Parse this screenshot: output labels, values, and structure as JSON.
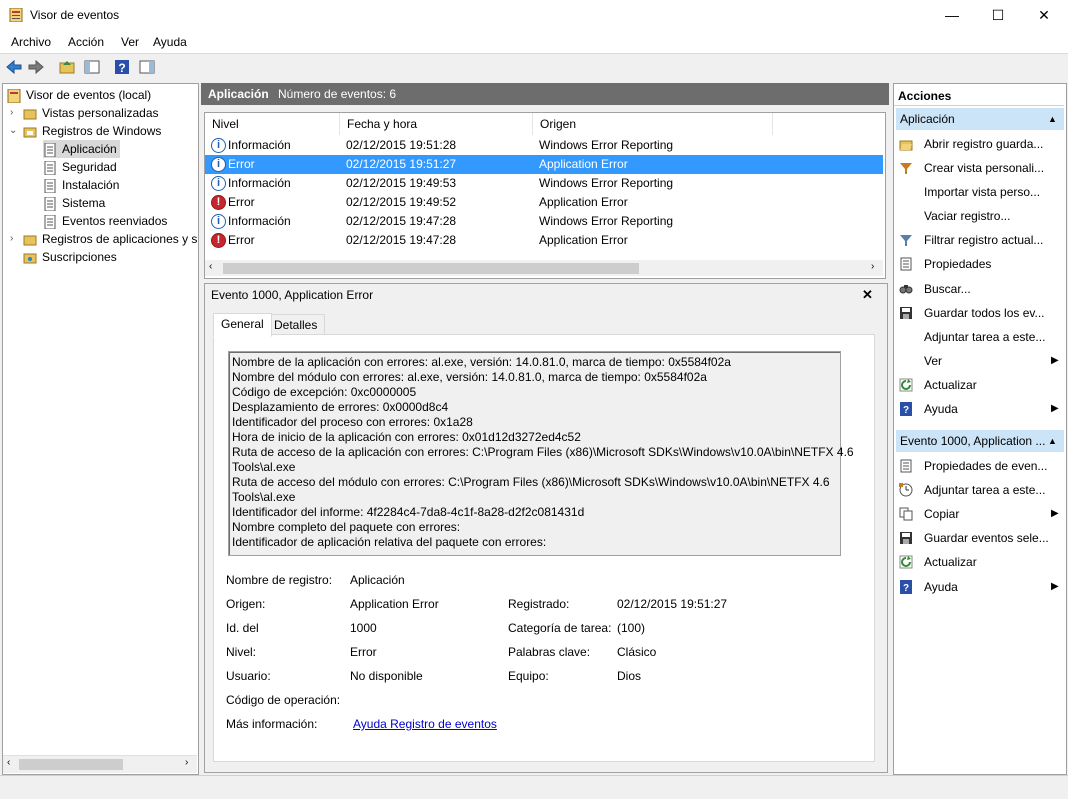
{
  "window": {
    "title": "Visor de eventos",
    "minimize": "—",
    "maximize": "☐",
    "close": "✕"
  },
  "menu": [
    "Archivo",
    "Acción",
    "Ver",
    "Ayuda"
  ],
  "tree": {
    "root": "Visor de eventos (local)",
    "custom_views": "Vistas personalizadas",
    "windows_logs": "Registros de Windows",
    "logs": [
      "Aplicación",
      "Seguridad",
      "Instalación",
      "Sistema",
      "Eventos reenviados"
    ],
    "app_services": "Registros de aplicaciones y s",
    "subscriptions": "Suscripciones"
  },
  "center": {
    "log_name": "Aplicación",
    "count_label": "Número de eventos: 6"
  },
  "columns": [
    "Nivel",
    "Fecha y hora",
    "Origen"
  ],
  "events": [
    {
      "level": "Información",
      "type": "info",
      "date": "02/12/2015 19:51:28",
      "source": "Windows Error Reporting"
    },
    {
      "level": "Error",
      "type": "err-info",
      "date": "02/12/2015 19:51:27",
      "source": "Application Error",
      "selected": true
    },
    {
      "level": "Información",
      "type": "info",
      "date": "02/12/2015 19:49:53",
      "source": "Windows Error Reporting"
    },
    {
      "level": "Error",
      "type": "err",
      "date": "02/12/2015 19:49:52",
      "source": "Application Error"
    },
    {
      "level": "Información",
      "type": "info",
      "date": "02/12/2015 19:47:28",
      "source": "Windows Error Reporting"
    },
    {
      "level": "Error",
      "type": "err",
      "date": "02/12/2015 19:47:28",
      "source": "Application Error"
    }
  ],
  "detail": {
    "title": "Evento 1000, Application Error",
    "close": "✕",
    "tabs": [
      "General",
      "Detalles"
    ],
    "message": [
      "Nombre de la aplicación con errores: al.exe, versión: 14.0.81.0, marca de tiempo: 0x5584f02a",
      "Nombre del módulo con errores: al.exe, versión: 14.0.81.0, marca de tiempo: 0x5584f02a",
      "Código de excepción: 0xc0000005",
      "Desplazamiento de errores: 0x0000d8c4",
      "Identificador del proceso con errores: 0x1a28",
      "Hora de inicio de la aplicación con errores: 0x01d12d3272ed4c52",
      "Ruta de acceso de la aplicación con errores: C:\\Program Files (x86)\\Microsoft SDKs\\Windows\\v10.0A\\bin\\NETFX 4.6",
      "Tools\\al.exe",
      "Ruta de acceso del módulo con errores: C:\\Program Files (x86)\\Microsoft SDKs\\Windows\\v10.0A\\bin\\NETFX 4.6",
      "Tools\\al.exe",
      "Identificador del informe: 4f2284c4-7da8-4c1f-8a28-d2f2c081431d",
      "Nombre completo del paquete con errores:",
      "Identificador de aplicación relativa del paquete con errores:"
    ],
    "fields": {
      "log_name_label": "Nombre de registro:",
      "log_name": "Aplicación",
      "source_label": "Origen:",
      "source": "Application Error",
      "logged_label": "Registrado:",
      "logged": "02/12/2015 19:51:27",
      "id_label": "Id. del",
      "id": "1000",
      "category_label": "Categoría de tarea:",
      "category": "(100)",
      "level_label": "Nivel:",
      "level": "Error",
      "keywords_label": "Palabras clave:",
      "keywords": "Clásico",
      "user_label": "Usuario:",
      "user": "No disponible",
      "computer_label": "Equipo:",
      "computer": "Dios",
      "opcode_label": "Código de operación:",
      "more_label": "Más información:",
      "more_link": "Ayuda Registro de eventos"
    }
  },
  "actions": {
    "header": "Acciones",
    "section1": "Aplicación",
    "items1": [
      {
        "label": "Abrir registro guarda...",
        "icon": "open-log-icon"
      },
      {
        "label": "Crear vista personali...",
        "icon": "filter-create-icon"
      },
      {
        "label": "Importar vista perso...",
        "icon": ""
      },
      {
        "label": "Vaciar registro...",
        "icon": ""
      },
      {
        "label": "Filtrar registro actual...",
        "icon": "filter-icon"
      },
      {
        "label": "Propiedades",
        "icon": "properties-icon"
      },
      {
        "label": "Buscar...",
        "icon": "find-icon"
      },
      {
        "label": "Guardar todos los ev...",
        "icon": "save-icon"
      },
      {
        "label": "Adjuntar tarea a este...",
        "icon": ""
      },
      {
        "label": "Ver",
        "icon": "",
        "submenu": true
      },
      {
        "label": "Actualizar",
        "icon": "refresh-icon"
      },
      {
        "label": "Ayuda",
        "icon": "help-icon",
        "submenu": true
      }
    ],
    "section2": "Evento 1000, Application ...",
    "items2": [
      {
        "label": "Propiedades de even...",
        "icon": "event-properties-icon"
      },
      {
        "label": "Adjuntar tarea a este...",
        "icon": "attach-task-icon"
      },
      {
        "label": "Copiar",
        "icon": "copy-icon",
        "submenu": true
      },
      {
        "label": "Guardar eventos sele...",
        "icon": "save-icon"
      },
      {
        "label": "Actualizar",
        "icon": "refresh-icon"
      },
      {
        "label": "Ayuda",
        "icon": "help-icon",
        "submenu": true
      }
    ]
  }
}
